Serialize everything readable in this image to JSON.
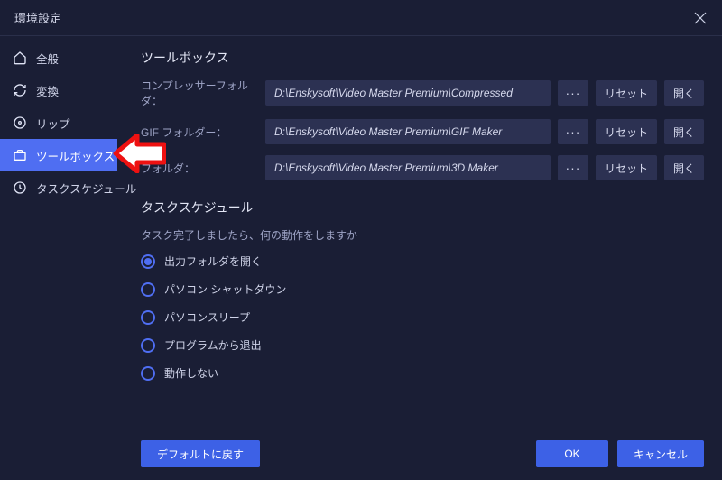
{
  "window": {
    "title": "環境設定"
  },
  "sidebar": {
    "items": [
      {
        "label": "全般"
      },
      {
        "label": "変換"
      },
      {
        "label": "リップ"
      },
      {
        "label": "ツールボックス"
      },
      {
        "label": "タスクスケジュール"
      }
    ]
  },
  "toolbox": {
    "section_title": "ツールボックス",
    "rows": [
      {
        "label": "コンプレッサーフォルダ：",
        "path": "D:\\Enskysoft\\Video Master Premium\\Compressed"
      },
      {
        "label": "GIF フォルダー：",
        "path": "D:\\Enskysoft\\Video Master Premium\\GIF Maker"
      },
      {
        "label": "フォルダ：",
        "path": "D:\\Enskysoft\\Video Master Premium\\3D Maker"
      }
    ],
    "browse": "···",
    "reset": "リセット",
    "open": "開く"
  },
  "schedule": {
    "section_title": "タスクスケジュール",
    "subtitle": "タスク完了しましたら、何の動作をしますか",
    "options": [
      "出力フォルダを開く",
      "パソコン シャットダウン",
      "パソコンスリープ",
      "プログラムから退出",
      "動作しない"
    ],
    "selected_index": 0
  },
  "footer": {
    "restore": "デフォルトに戻す",
    "ok": "OK",
    "cancel": "キャンセル"
  }
}
